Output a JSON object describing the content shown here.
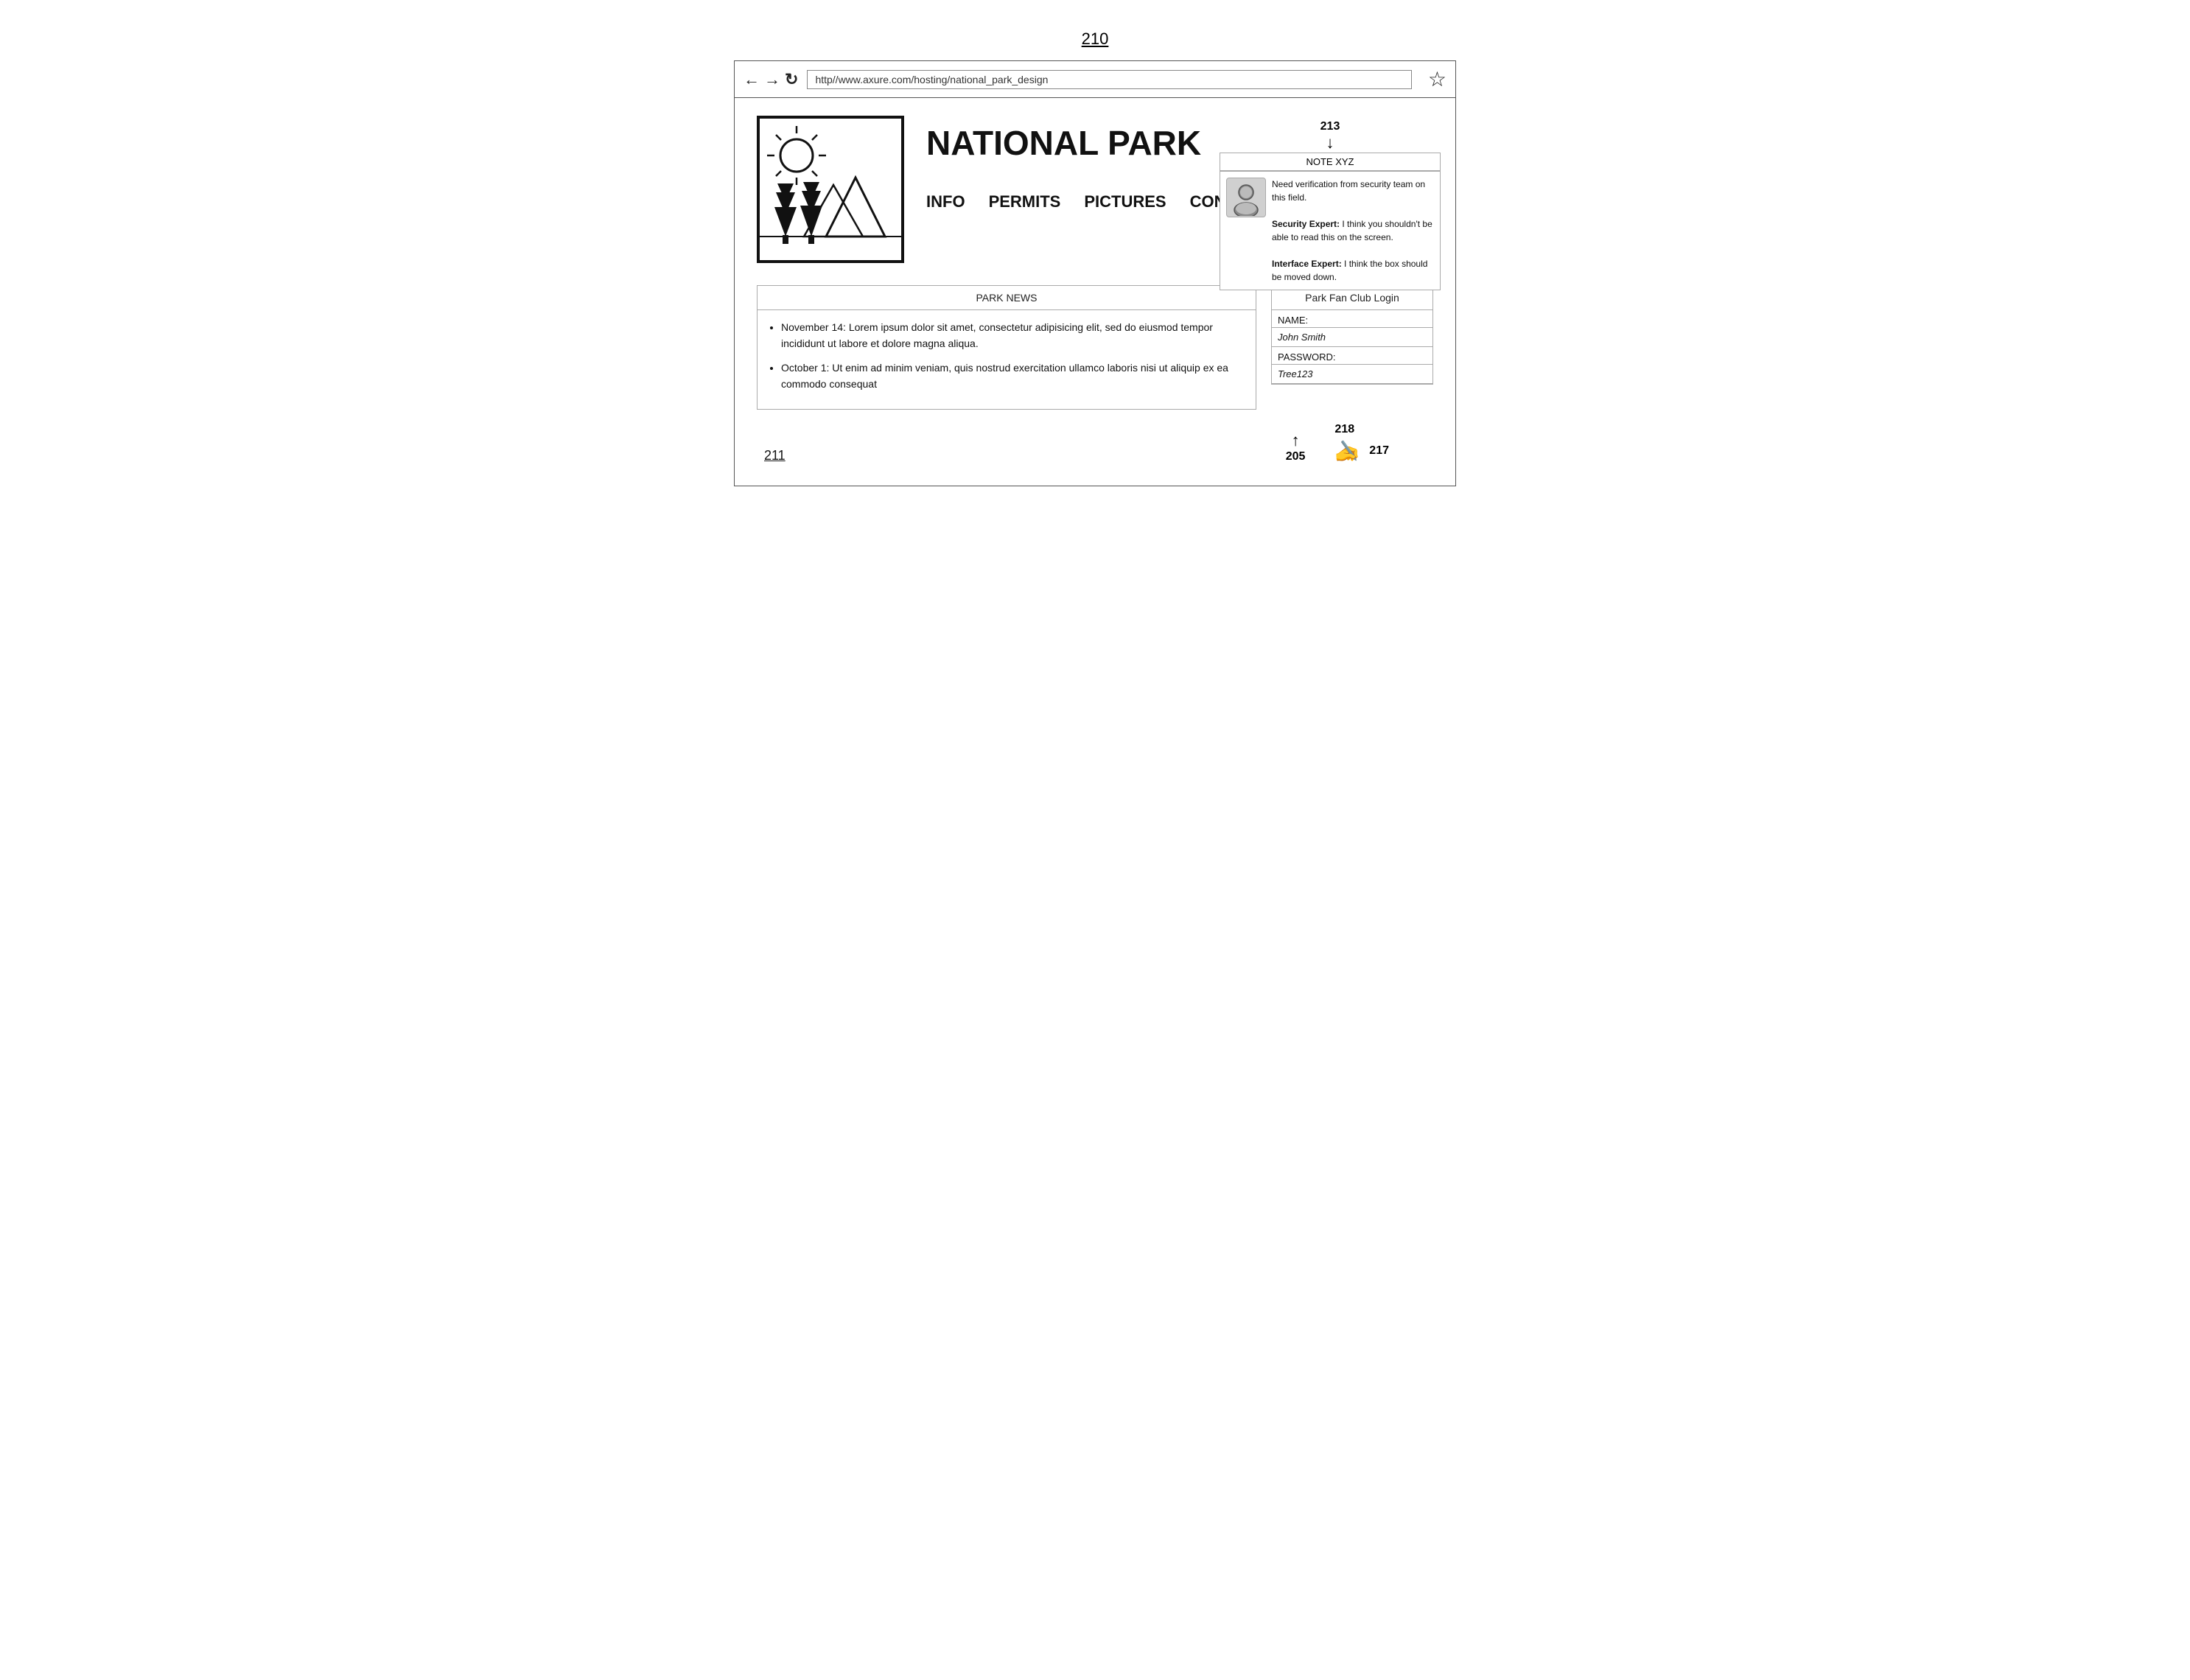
{
  "page": {
    "label": "210"
  },
  "browser": {
    "url": "http//www.axure.com/hosting/national_park_design",
    "back_icon": "←",
    "forward_icon": "→",
    "refresh_icon": "↻",
    "star_icon": "☆"
  },
  "header": {
    "site_title": "NATIONAL PARK",
    "nav_items": [
      "INFO",
      "PERMITS",
      "PICTURES",
      "CONTACT"
    ]
  },
  "note": {
    "number": "213",
    "label": "NOTE XYZ",
    "text_lines": [
      "Need verification from security team on this field.",
      "Security Expert: I think you shouldn't be able to read this on the screen.",
      "Interface Expert: I think the box should be moved down."
    ]
  },
  "news": {
    "header": "PARK NEWS",
    "items": [
      "November 14: Lorem ipsum dolor sit amet, consectetur adipisicing elit, sed do eiusmod tempor incididunt ut labore et dolore magna aliqua.",
      "October 1: Ut enim ad minim veniam, quis nostrud exercitation ullamco laboris nisi ut aliquip ex ea commodo consequat"
    ]
  },
  "login": {
    "header": "Park Fan Club Login",
    "name_label": "NAME:",
    "name_value": "John Smith",
    "password_label": "PASSWORD:",
    "password_value": "Tree123"
  },
  "annotations": {
    "bottom_link": "211",
    "arrow_205": "205",
    "arrow_217": "217",
    "arrow_218": "218"
  }
}
